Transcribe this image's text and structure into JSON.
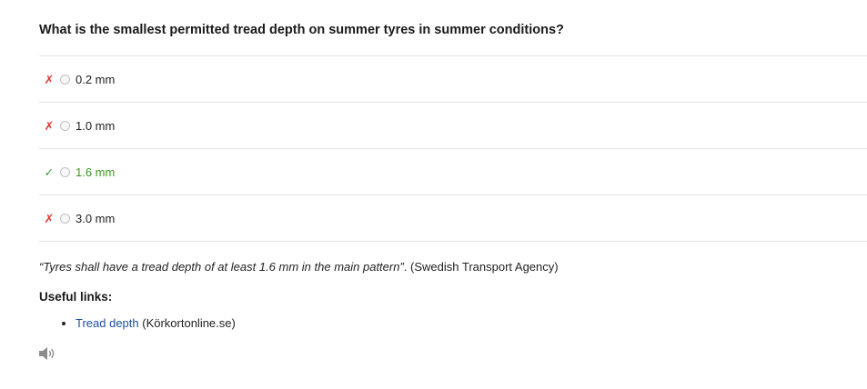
{
  "question": "What is the smallest permitted tread depth on summer tyres in summer conditions?",
  "options": [
    {
      "label": "0.2 mm",
      "mark": "✗",
      "mark_icon": "cross-icon",
      "status": "wrong"
    },
    {
      "label": "1.0 mm",
      "mark": "✗",
      "mark_icon": "cross-icon",
      "status": "wrong"
    },
    {
      "label": "1.6 mm",
      "mark": "✓",
      "mark_icon": "check-icon",
      "status": "correct"
    },
    {
      "label": "3.0 mm",
      "mark": "✗",
      "mark_icon": "cross-icon",
      "status": "wrong"
    }
  ],
  "explanation": {
    "quote": "“Tyres shall have a tread depth of at least 1.6 mm in the main pattern”",
    "source": ". (Swedish Transport Agency)"
  },
  "useful_links": {
    "heading": "Useful links:",
    "items": [
      {
        "link_text": "Tread depth",
        "suffix": " (Körkortonline.se)"
      }
    ]
  },
  "audio": {
    "icon": "speaker-icon"
  },
  "colors": {
    "wrong": "#e53935",
    "correct": "#3a9a1f",
    "link": "#1f4e9c"
  }
}
